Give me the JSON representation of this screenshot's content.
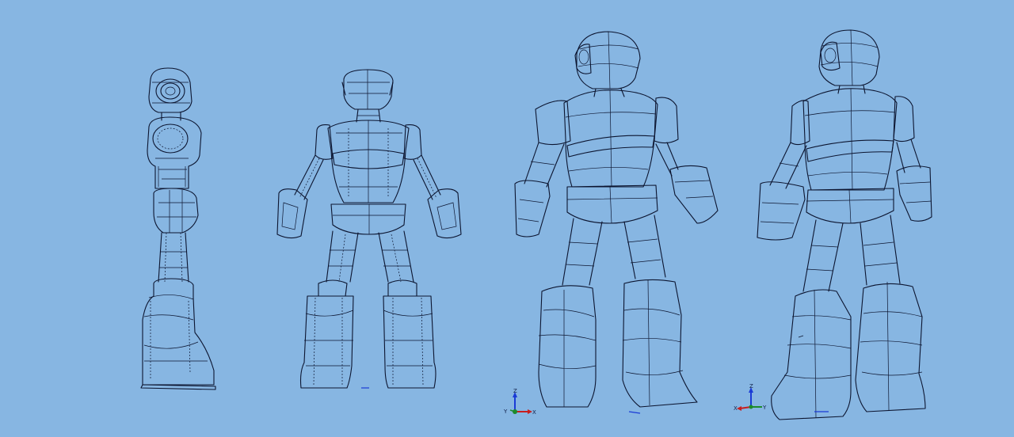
{
  "viewport": {
    "background_color": "#87b6e2",
    "line_color": "#0c1530"
  },
  "views": [
    {
      "id": "side-view"
    },
    {
      "id": "front-view"
    },
    {
      "id": "iso-front-view"
    },
    {
      "id": "iso-rear-view"
    }
  ],
  "triads": [
    {
      "id": "triad-1",
      "labels": {
        "z": "Z",
        "x": "X",
        "y": "Y"
      },
      "colors": {
        "z": "#1a3bd6",
        "x": "#c81e1e",
        "y": "#1c8a2c"
      }
    },
    {
      "id": "triad-2",
      "labels": {
        "z": "Z",
        "x": "X",
        "y": "Y"
      },
      "colors": {
        "z": "#1a3bd6",
        "x": "#c81e1e",
        "y": "#1c8a2c"
      }
    }
  ]
}
